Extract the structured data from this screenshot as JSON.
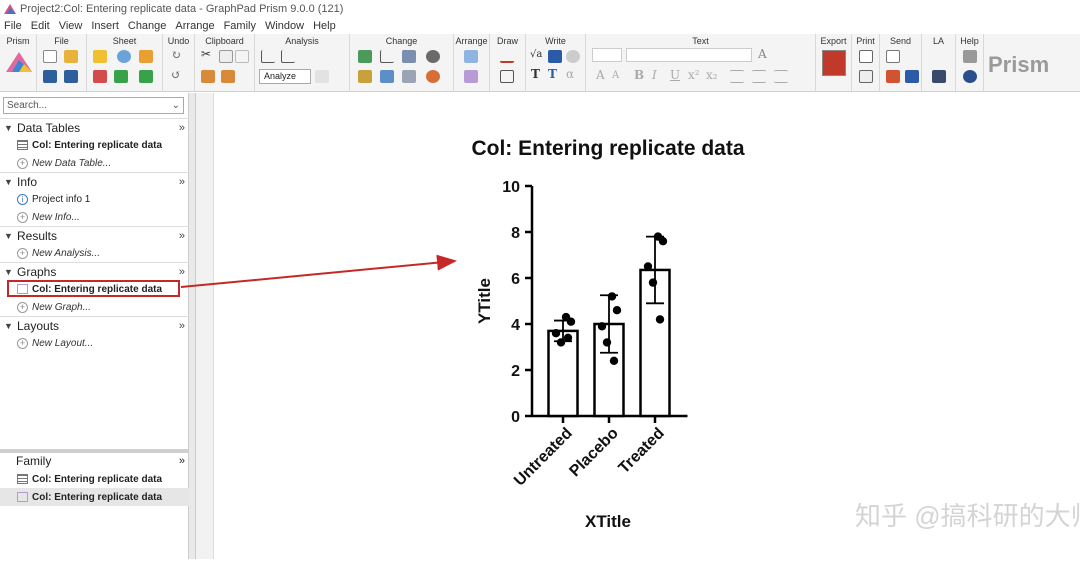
{
  "window_title": "Project2:Col: Entering replicate data - GraphPad Prism 9.0.0 (121)",
  "menu": [
    "File",
    "Edit",
    "View",
    "Insert",
    "Change",
    "Arrange",
    "Family",
    "Window",
    "Help"
  ],
  "ribbon_groups": [
    "Prism",
    "File",
    "Sheet",
    "Undo",
    "Clipboard",
    "Analysis",
    "Change",
    "Arrange",
    "Draw",
    "Write",
    "Text",
    "Export",
    "Print",
    "Send",
    "LA",
    "Help"
  ],
  "analyze_label": "Analyze",
  "brand": "Prism",
  "search": {
    "placeholder": "Search..."
  },
  "navigator": {
    "data_tables": {
      "title": "Data Tables",
      "items": [
        "Col: Entering replicate data"
      ],
      "new": "New Data Table..."
    },
    "info": {
      "title": "Info",
      "items": [
        "Project info 1"
      ],
      "new": "New Info..."
    },
    "results": {
      "title": "Results",
      "new": "New Analysis..."
    },
    "graphs": {
      "title": "Graphs",
      "items": [
        "Col: Entering replicate data"
      ],
      "new": "New Graph..."
    },
    "layouts": {
      "title": "Layouts",
      "new": "New Layout..."
    }
  },
  "family": {
    "title": "Family",
    "items": [
      "Col: Entering replicate data",
      "Col: Entering replicate data"
    ]
  },
  "watermark": "知乎 @搞科研的大师兄",
  "colors": {
    "highlight_box": "#c62828",
    "arrow": "#c62828"
  },
  "chart_data": {
    "type": "bar",
    "title": "Col: Entering replicate data",
    "xlabel": "XTitle",
    "ylabel": "YTitle",
    "ylim": [
      0,
      10
    ],
    "yticks": [
      0,
      2,
      4,
      6,
      8,
      10
    ],
    "categories": [
      "Untreated",
      "Placebo",
      "Treated"
    ],
    "values": [
      3.7,
      4.0,
      6.35
    ],
    "sd": [
      0.45,
      1.25,
      1.45
    ],
    "points": [
      [
        4.3,
        4.1,
        3.6,
        3.2,
        3.4
      ],
      [
        5.2,
        4.6,
        3.9,
        3.2,
        2.4
      ],
      [
        7.8,
        7.6,
        6.5,
        5.8,
        4.2
      ]
    ]
  }
}
